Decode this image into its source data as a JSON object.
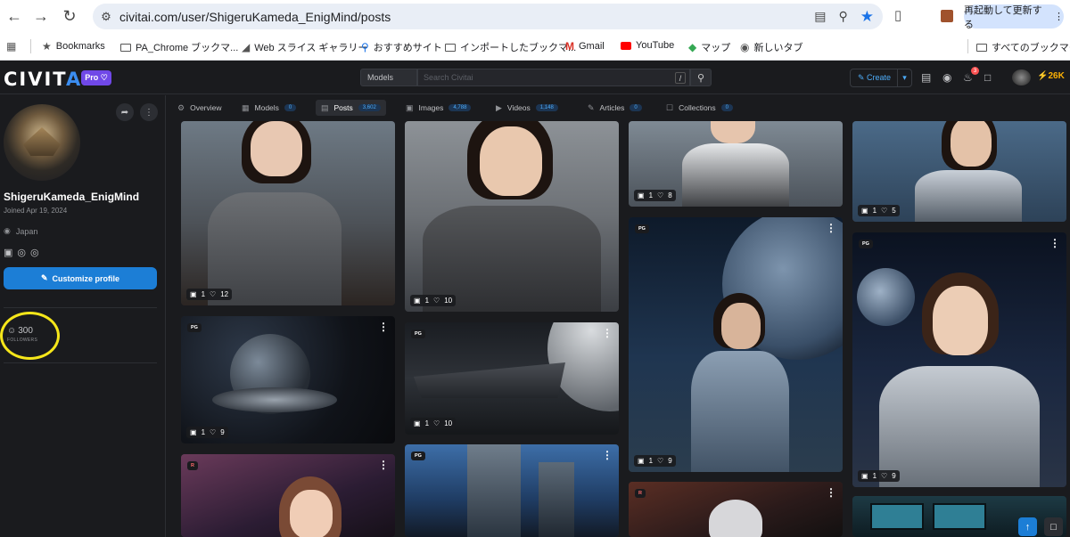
{
  "browser": {
    "url": "civitai.com/user/ShigeruKameda_EnigMind/posts",
    "restart_label": "再起動して更新する",
    "bookmarks": [
      {
        "label": "Bookmarks",
        "icon": "star-icon"
      },
      {
        "label": "PA_Chrome ブックマ...",
        "icon": "folder-icon"
      },
      {
        "label": "Web スライス ギャラリー",
        "icon": "web-slice-icon"
      },
      {
        "label": "おすすめサイト",
        "icon": "search-icon"
      },
      {
        "label": "インポートしたブックマ...",
        "icon": "folder-icon"
      },
      {
        "label": "Gmail",
        "icon": "gmail-icon"
      },
      {
        "label": "YouTube",
        "icon": "youtube-icon"
      },
      {
        "label": "マップ",
        "icon": "maps-icon"
      },
      {
        "label": "新しいタブ",
        "icon": "globe-icon"
      }
    ],
    "all_bookmarks_label": "すべてのブックマーク"
  },
  "header": {
    "logo_main": "CIVIT",
    "logo_accent": "AI",
    "pro_label": "Pro ♡",
    "search_scope": "Models",
    "search_placeholder": "Search Civitai",
    "search_kbd": "/",
    "create_label": "Create",
    "notification_count": "3",
    "buzz_amount": "26K"
  },
  "profile": {
    "username": "ShigeruKameda_EnigMind",
    "joined": "Joined Apr 19, 2024",
    "location": "Japan",
    "customize_label": "Customize profile",
    "followers_count": "300",
    "followers_label": "FOLLOWERS"
  },
  "tabs": [
    {
      "label": "Overview",
      "count": null,
      "icon": "home-icon",
      "active": false
    },
    {
      "label": "Models",
      "count": "0",
      "icon": "models-icon",
      "active": false
    },
    {
      "label": "Posts",
      "count": "3,602",
      "icon": "posts-icon",
      "active": true
    },
    {
      "label": "Images",
      "count": "4,788",
      "icon": "image-icon",
      "active": false
    },
    {
      "label": "Videos",
      "count": "1,148",
      "icon": "video-icon",
      "active": false
    },
    {
      "label": "Articles",
      "count": "0",
      "icon": "pen-icon",
      "active": false
    },
    {
      "label": "Collections",
      "count": "0",
      "icon": "bookmark-icon",
      "active": false
    }
  ],
  "posts": [
    {
      "id": "c1",
      "rating": "",
      "images": "1",
      "likes": "12"
    },
    {
      "id": "c2",
      "rating": "",
      "images": "1",
      "likes": "10"
    },
    {
      "id": "c3",
      "rating": "",
      "images": "1",
      "likes": "8"
    },
    {
      "id": "c4",
      "rating": "",
      "images": "1",
      "likes": "5"
    },
    {
      "id": "c5",
      "rating": "PG",
      "images": "1",
      "likes": "9"
    },
    {
      "id": "c6",
      "rating": "PG",
      "images": "1",
      "likes": "10"
    },
    {
      "id": "c7",
      "rating": "PG",
      "images": "1",
      "likes": "9"
    },
    {
      "id": "c8",
      "rating": "PG",
      "images": "1",
      "likes": "9"
    },
    {
      "id": "c9",
      "rating": "R",
      "images": "",
      "likes": ""
    },
    {
      "id": "c10",
      "rating": "PG",
      "images": "",
      "likes": ""
    },
    {
      "id": "c11",
      "rating": "R",
      "images": "",
      "likes": ""
    },
    {
      "id": "c12",
      "rating": "",
      "images": "",
      "likes": ""
    }
  ],
  "colors": {
    "accent": "#1c7ed6",
    "annotation": "#f5e61a",
    "background": "#1a1b1e"
  }
}
